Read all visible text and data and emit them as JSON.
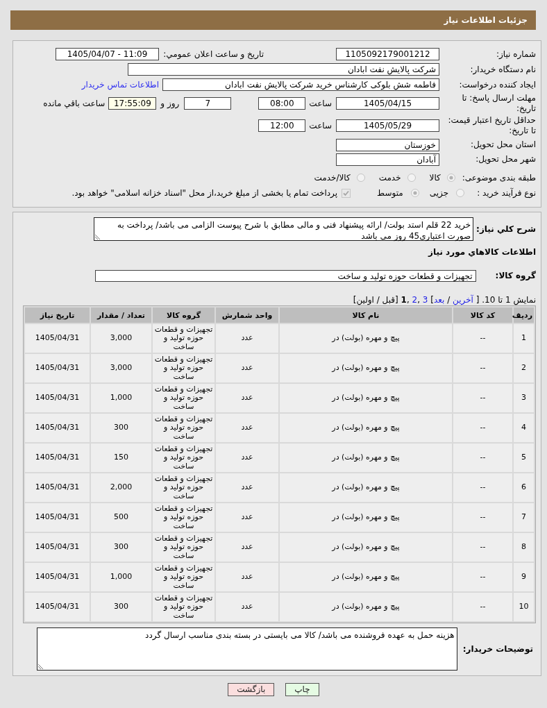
{
  "header": {
    "title": "جزئیات اطلاعات نیاز"
  },
  "form": {
    "need_number": {
      "label": "شماره نیاز:",
      "value": "1105092179001212"
    },
    "announce_datetime": {
      "label": "تاریخ و ساعت اعلان عمومي:",
      "value": "1405/04/07 - 11:09"
    },
    "buyer_org": {
      "label": "نام دستگاه خریدار:",
      "value": "شرکت پالایش نفت ابادان"
    },
    "requester": {
      "label": "ایجاد کننده درخواست:",
      "value": "فاطمه شش بلوکی کارشناس خرید شرکت پالایش نفت ابادان",
      "contact_link": "اطلاعات تماس خریدار"
    },
    "response_deadline": {
      "label": "مهلت ارسال پاسخ: تا تاریخ:",
      "date": "1405/04/15",
      "time_label": "ساعت",
      "time": "08:00",
      "days": "7",
      "days_label": "روز و",
      "remaining": "17:55:09",
      "remaining_label": "ساعت باقي مانده"
    },
    "price_validity": {
      "label": "حداقل تاریخ اعتبار قیمت: تا تاریخ:",
      "date": "1405/05/29",
      "time_label": "ساعت",
      "time": "12:00"
    },
    "delivery_province": {
      "label": "استان محل تحویل:",
      "value": "خوزستان"
    },
    "delivery_city": {
      "label": "شهر محل تحویل:",
      "value": "آبادان"
    },
    "subject_category": {
      "label": "طبقه بندی موضوعی:",
      "options": [
        {
          "label": "کالا",
          "selected": true
        },
        {
          "label": "خدمت",
          "selected": false
        },
        {
          "label": "کالا/خدمت",
          "selected": false
        }
      ]
    },
    "purchase_process": {
      "label": "نوع فرآیند خرید :",
      "options": [
        {
          "label": "جزیی",
          "selected": false
        },
        {
          "label": "متوسط",
          "selected": true
        }
      ],
      "treasury_payment": {
        "label": "پرداخت تمام یا بخشی از مبلغ خرید،از محل \"اسناد خزانه اسلامی\" خواهد بود.",
        "checked": true
      }
    }
  },
  "description": {
    "label": "شرح کلي نیاز:",
    "value": "خرید 22 قلم استد بولت/ ارائه پیشنهاد فنی و مالی مطابق با شرح پیوست الزامی می باشد/ پرداخت به صورت اعتباری45 روز می باشد"
  },
  "goods_section": {
    "title": "اطلاعات کالاهاي مورد نياز",
    "group_label": "گروه کالا:",
    "group_value": "تجهیزات و قطعات حوزه تولید و ساخت"
  },
  "pagination": {
    "parts": [
      {
        "kind": "text",
        "text": "نمایش 1 تا 10. [ "
      },
      {
        "kind": "link",
        "text": "آخرین"
      },
      {
        "kind": "text",
        "text": " / "
      },
      {
        "kind": "link",
        "text": "بعد"
      },
      {
        "kind": "text",
        "text": "] "
      },
      {
        "kind": "link",
        "text": "3"
      },
      {
        "kind": "text",
        "text": " ,"
      },
      {
        "kind": "link",
        "text": "2"
      },
      {
        "kind": "text",
        "text": " ,"
      },
      {
        "kind": "current",
        "text": "1"
      },
      {
        "kind": "text",
        "text": " [قبل / اولین]"
      }
    ]
  },
  "table": {
    "columns": [
      "ردیف",
      "کد کالا",
      "نام کالا",
      "واحد شمارش",
      "گروه کالا",
      "تعداد / مقدار",
      "تاریخ نیاز"
    ],
    "rows": [
      [
        "1",
        "--",
        "پیچ و مهره (بولت) در",
        "عدد",
        "تجهیزات و قطعات حوزه تولید و ساخت",
        "3,000",
        "1405/04/31"
      ],
      [
        "2",
        "--",
        "پیچ و مهره (بولت) در",
        "عدد",
        "تجهیزات و قطعات حوزه تولید و ساخت",
        "3,000",
        "1405/04/31"
      ],
      [
        "3",
        "--",
        "پیچ و مهره (بولت) در",
        "عدد",
        "تجهیزات و قطعات حوزه تولید و ساخت",
        "1,000",
        "1405/04/31"
      ],
      [
        "4",
        "--",
        "پیچ و مهره (بولت) در",
        "عدد",
        "تجهیزات و قطعات حوزه تولید و ساخت",
        "300",
        "1405/04/31"
      ],
      [
        "5",
        "--",
        "پیچ و مهره (بولت) در",
        "عدد",
        "تجهیزات و قطعات حوزه تولید و ساخت",
        "150",
        "1405/04/31"
      ],
      [
        "6",
        "--",
        "پیچ و مهره (بولت) در",
        "عدد",
        "تجهیزات و قطعات حوزه تولید و ساخت",
        "2,000",
        "1405/04/31"
      ],
      [
        "7",
        "--",
        "پیچ و مهره (بولت) در",
        "عدد",
        "تجهیزات و قطعات حوزه تولید و ساخت",
        "500",
        "1405/04/31"
      ],
      [
        "8",
        "--",
        "پیچ و مهره (بولت) در",
        "عدد",
        "تجهیزات و قطعات حوزه تولید و ساخت",
        "300",
        "1405/04/31"
      ],
      [
        "9",
        "--",
        "پیچ و مهره (بولت) در",
        "عدد",
        "تجهیزات و قطعات حوزه تولید و ساخت",
        "1,000",
        "1405/04/31"
      ],
      [
        "10",
        "--",
        "پیچ و مهره (بولت) در",
        "عدد",
        "تجهیزات و قطعات حوزه تولید و ساخت",
        "300",
        "1405/04/31"
      ]
    ]
  },
  "buyer_notes": {
    "label": "توضیحات خریدار:",
    "value": "هزینه حمل به عهده فروشنده می باشد/ کالا می بایستی در بسته بندی مناسب ارسال گردد"
  },
  "buttons": [
    {
      "label": "چاپ",
      "kind": "print"
    },
    {
      "label": "بازگشت",
      "kind": "back"
    }
  ]
}
